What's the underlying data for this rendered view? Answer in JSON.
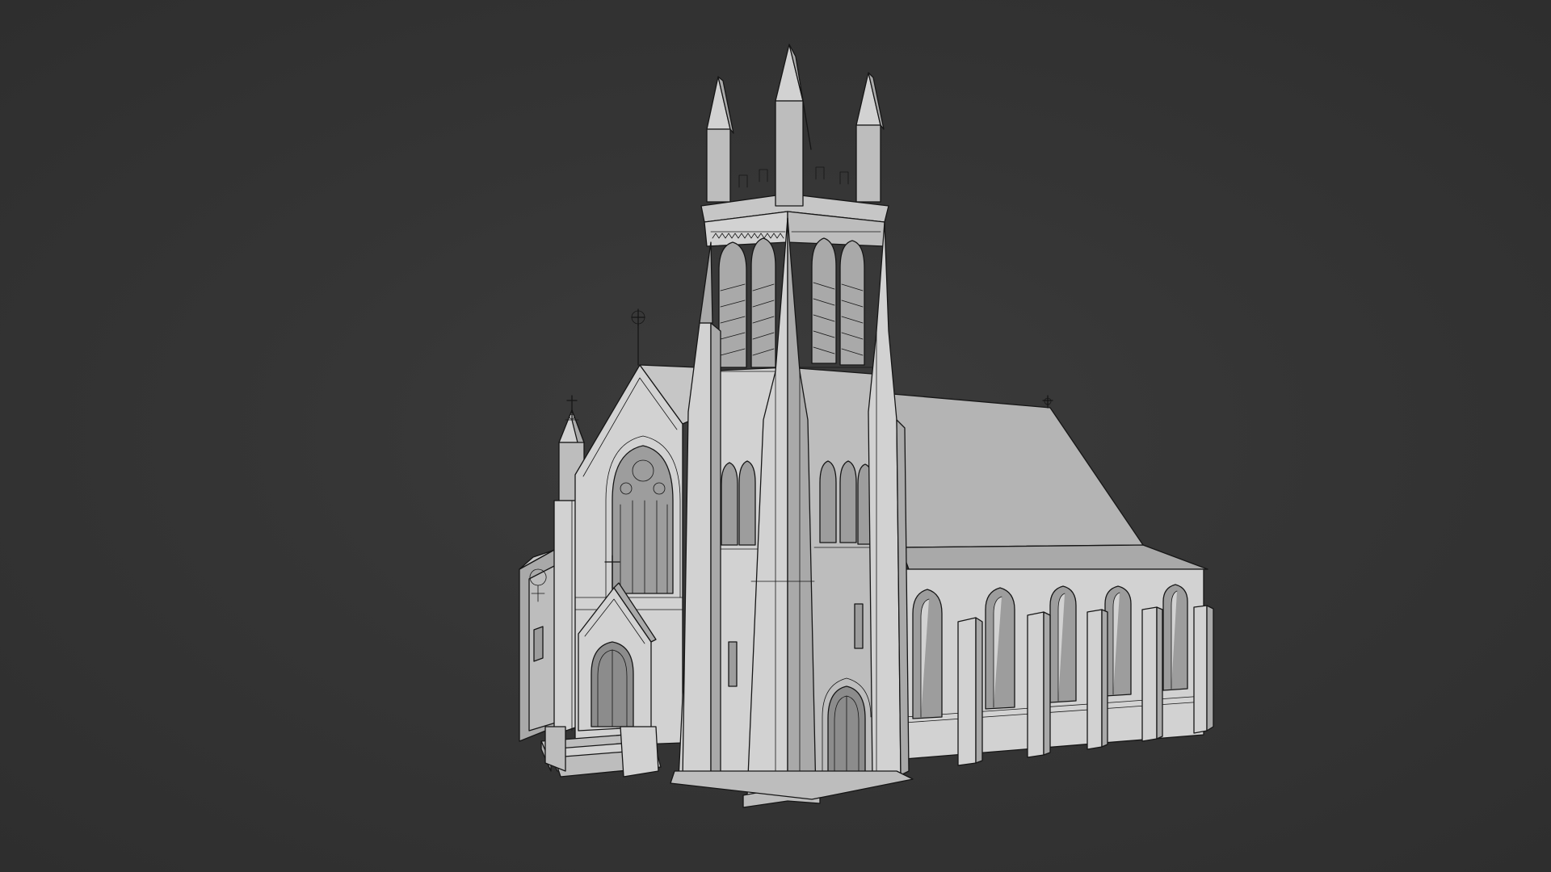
{
  "viewport": {
    "background": "#333333",
    "model_color": "#c8c8c8",
    "wire_color": "#161616"
  },
  "model": {
    "subject": "church-3d-model",
    "shading": "solid-with-wireframe"
  }
}
